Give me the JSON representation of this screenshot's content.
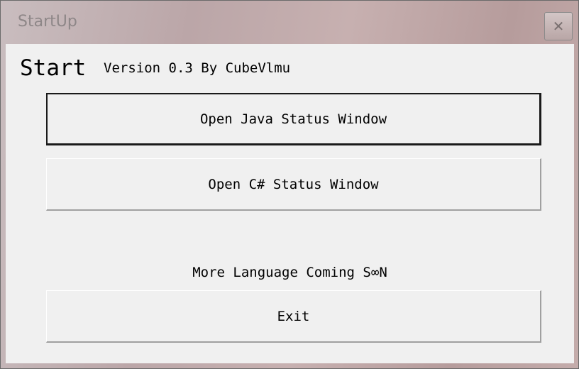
{
  "window": {
    "title": "StartUp",
    "close_glyph": "✕"
  },
  "header": {
    "heading": "Start",
    "version_text": "Version 0.3 By CubeVlmu"
  },
  "buttons": {
    "java": "Open Java Status Window",
    "csharp": "Open C# Status Window",
    "exit": "Exit"
  },
  "note": "More Language Coming S∞N"
}
